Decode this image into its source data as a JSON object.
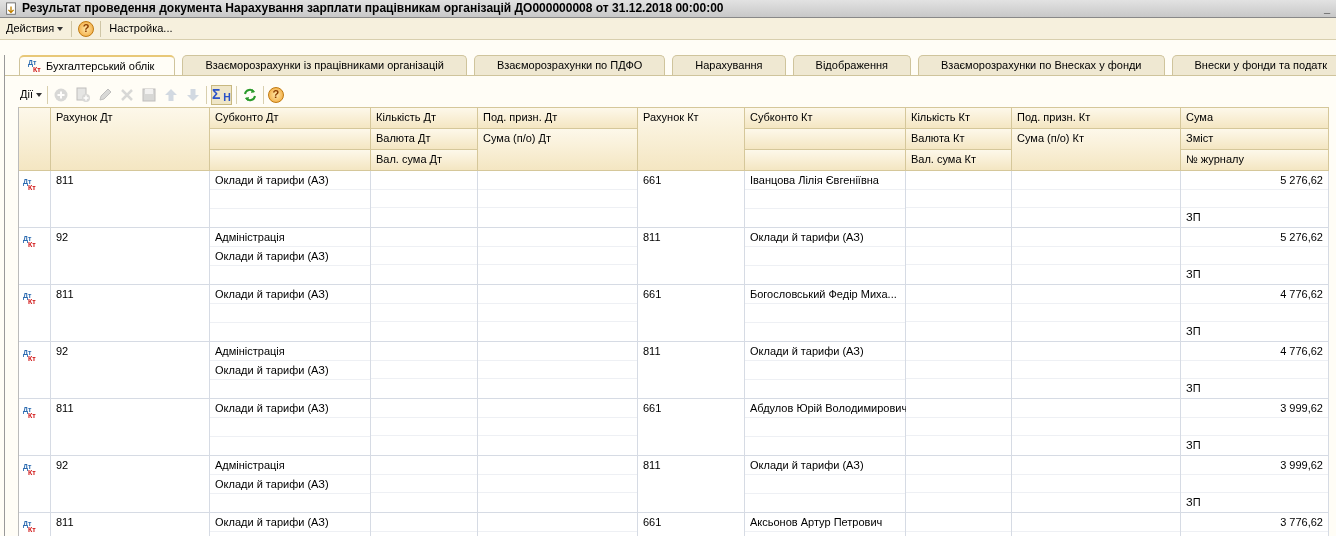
{
  "window": {
    "title": "Результат проведення документа Нарахування зарплати працівникам організацій ДО000000008 от 31.12.2018 00:00:00",
    "minimize_glyph": "_"
  },
  "menu": [
    {
      "kind": "dropdown",
      "label": "Действия"
    },
    {
      "kind": "help",
      "label": "?"
    },
    {
      "kind": "item",
      "label": "Настройка..."
    }
  ],
  "tabs": [
    {
      "label": "Бухгалтерський облік",
      "selected": true,
      "mark_dt": "Дт",
      "mark_kt": "Кт"
    },
    {
      "label": "Взаєморозрахунки із працівниками організацій",
      "selected": false
    },
    {
      "label": "Взаєморозрахунки по ПДФО",
      "selected": false
    },
    {
      "label": "Нарахування",
      "selected": false
    },
    {
      "label": "Відображення",
      "selected": false
    },
    {
      "label": "Взаєморозрахунки по Внесках у фонди",
      "selected": false
    },
    {
      "label": "Внески у фонди та податк",
      "selected": false
    }
  ],
  "toolbar": [
    {
      "kind": "dropdown",
      "label": "Дії",
      "disabled": false
    },
    {
      "kind": "add",
      "disabled": true
    },
    {
      "kind": "copy",
      "disabled": true
    },
    {
      "kind": "edit",
      "disabled": true
    },
    {
      "kind": "delete",
      "disabled": true
    },
    {
      "kind": "save",
      "disabled": true
    },
    {
      "kind": "up",
      "disabled": true
    },
    {
      "kind": "down",
      "disabled": true
    },
    {
      "kind": "sum",
      "label": "Σ$_{Н}$",
      "disabled": false,
      "selected": true
    },
    {
      "kind": "refresh",
      "disabled": false
    },
    {
      "kind": "help",
      "label": "?",
      "disabled": false
    }
  ],
  "table": {
    "columns": [
      {
        "kind": "merged",
        "lines": [
          "Рахунок Дт"
        ]
      },
      {
        "kind": "stacked",
        "lines": [
          "Субконто Дт"
        ]
      },
      {
        "kind": "stacked",
        "lines": [
          "Кількість Дт",
          "Валюта Дт",
          "Вал. сума Дт"
        ]
      },
      {
        "kind": "merged",
        "lines": [
          "Под. призн. Дт",
          "Сума (п/о) Дт"
        ]
      },
      {
        "kind": "merged",
        "lines": [
          "Рахунок Кт"
        ]
      },
      {
        "kind": "stacked",
        "lines": [
          "Субконто Кт"
        ]
      },
      {
        "kind": "stacked",
        "lines": [
          "Кількість Кт",
          "Валюта Кт",
          "Вал. сума Кт"
        ]
      },
      {
        "kind": "merged",
        "lines": [
          "Под. призн. Кт",
          "Сума (п/о) Кт"
        ]
      },
      {
        "kind": "stacked",
        "lines": [
          "Сума",
          "Зміст",
          "№ журналу"
        ]
      }
    ],
    "rows": [
      {
        "mark_dt": "Дт",
        "mark_kt": "Кт",
        "account_dt": "811",
        "subconto_dt": [
          "Оклади й тарифи (АЗ)"
        ],
        "account_kt": "661",
        "subconto_kt": [
          "Іванцова Лілія Євгеніївна"
        ],
        "amount": "5 276,62",
        "journal": "ЗП"
      },
      {
        "mark_dt": "Дт",
        "mark_kt": "Кт",
        "account_dt": "92",
        "subconto_dt": [
          "Адміністрація",
          "Оклади й тарифи (АЗ)"
        ],
        "account_kt": "811",
        "subconto_kt": [
          "Оклади й тарифи (АЗ)"
        ],
        "amount": "5 276,62",
        "journal": "ЗП"
      },
      {
        "mark_dt": "Дт",
        "mark_kt": "Кт",
        "account_dt": "811",
        "subconto_dt": [
          "Оклади й тарифи (АЗ)"
        ],
        "account_kt": "661",
        "subconto_kt": [
          "Богословський Федір Миха..."
        ],
        "amount": "4 776,62",
        "journal": "ЗП"
      },
      {
        "mark_dt": "Дт",
        "mark_kt": "Кт",
        "account_dt": "92",
        "subconto_dt": [
          "Адміністрація",
          "Оклади й тарифи (АЗ)"
        ],
        "account_kt": "811",
        "subconto_kt": [
          "Оклади й тарифи (АЗ)"
        ],
        "amount": "4 776,62",
        "journal": "ЗП"
      },
      {
        "mark_dt": "Дт",
        "mark_kt": "Кт",
        "account_dt": "811",
        "subconto_dt": [
          "Оклади й тарифи (АЗ)"
        ],
        "account_kt": "661",
        "subconto_kt": [
          "Абдулов Юрій Володимирович"
        ],
        "amount": "3 999,62",
        "journal": "ЗП"
      },
      {
        "mark_dt": "Дт",
        "mark_kt": "Кт",
        "account_dt": "92",
        "subconto_dt": [
          "Адміністрація",
          "Оклади й тарифи (АЗ)"
        ],
        "account_kt": "811",
        "subconto_kt": [
          "Оклади й тарифи (АЗ)"
        ],
        "amount": "3 999,62",
        "journal": "ЗП"
      },
      {
        "mark_dt": "Дт",
        "mark_kt": "Кт",
        "account_dt": "811",
        "subconto_dt": [
          "Оклади й тарифи (АЗ)"
        ],
        "account_kt": "661",
        "subconto_kt": [
          "Аксьонов Артур Петрович"
        ],
        "amount": "3 776,62"
      }
    ]
  }
}
